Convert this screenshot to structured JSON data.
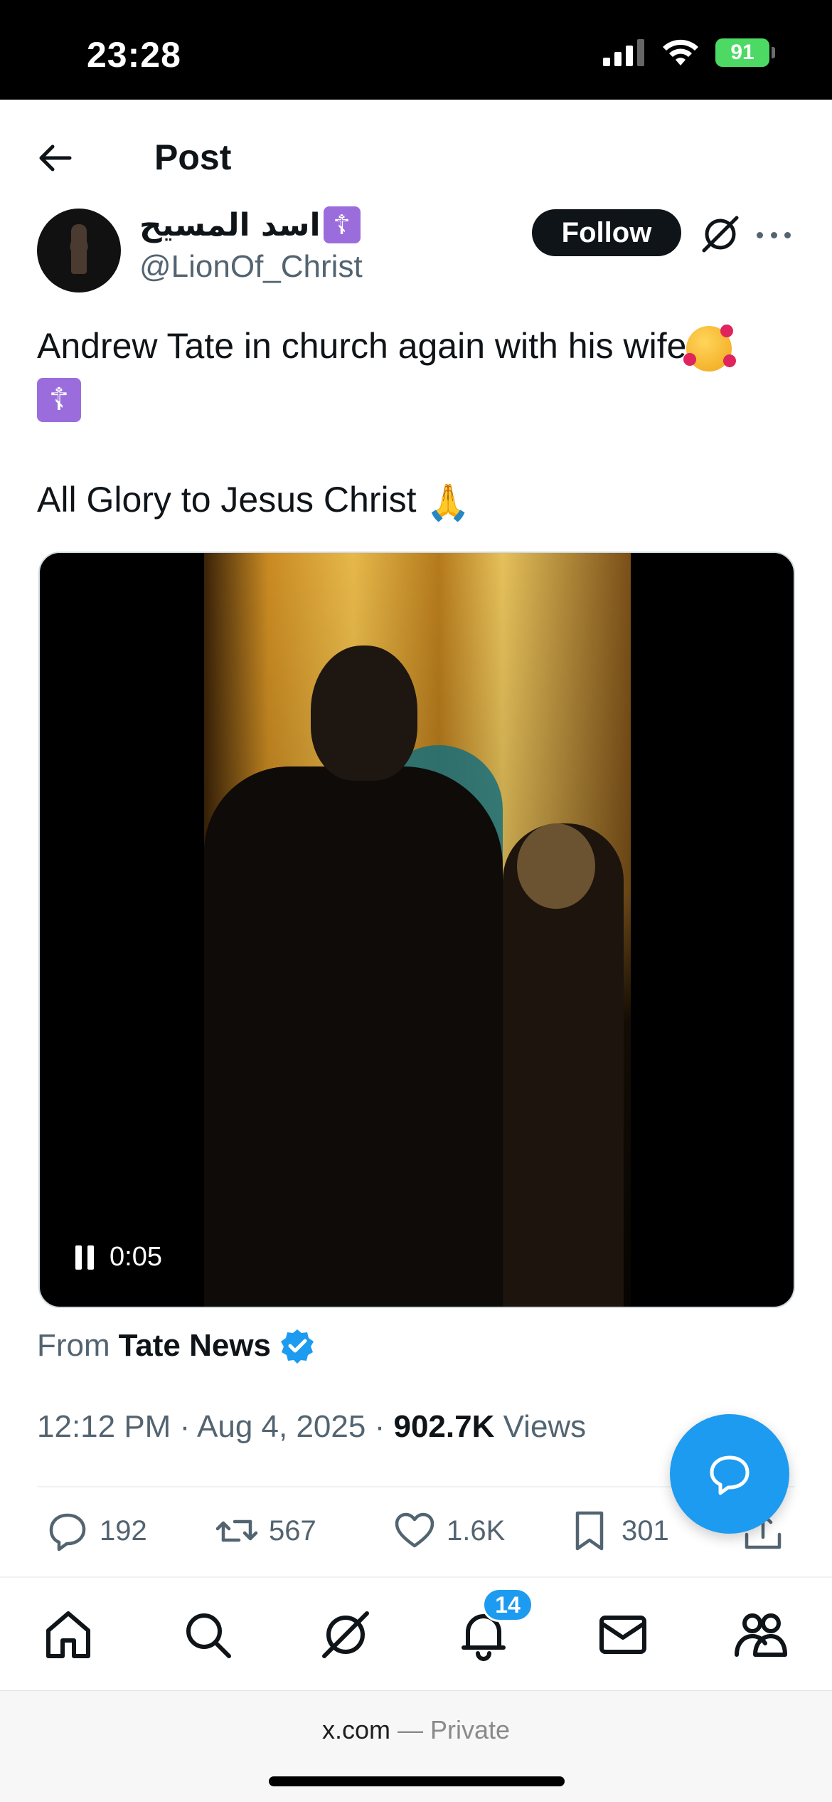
{
  "status_bar": {
    "time": "23:28",
    "battery": "91"
  },
  "header": {
    "title": "Post"
  },
  "author": {
    "display_name": "اسد المسيح",
    "badge": "☦",
    "handle": "@LionOf_Christ",
    "follow_label": "Follow"
  },
  "tweet": {
    "line1": "Andrew Tate in church again with his wife",
    "line3": "All Glory to Jesus Christ",
    "emoji_cross": "☦",
    "emoji_pray": "🙏"
  },
  "video": {
    "time": "0:05"
  },
  "source": {
    "prefix": "From",
    "name": "Tate News"
  },
  "meta": {
    "time": "12:12 PM",
    "date": "Aug 4, 2025",
    "views_count": "902.7K",
    "views_label": "Views",
    "separator": "·"
  },
  "actions": {
    "replies": "192",
    "reposts": "567",
    "likes": "1.6K",
    "bookmarks": "301"
  },
  "nav": {
    "notifications_badge": "14"
  },
  "browser": {
    "domain": "x.com",
    "mode": "— Private"
  },
  "colors": {
    "accent": "#1d9bf0",
    "text": "#0f1419",
    "muted": "#536471",
    "battery": "#4cd964",
    "badge_purple": "#9b6ddc"
  }
}
